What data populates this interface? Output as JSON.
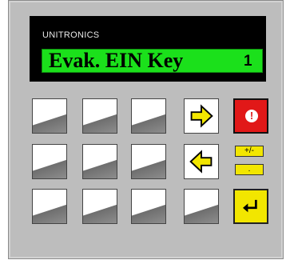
{
  "display": {
    "brand": "UNITRONICS",
    "message": "Evak. EIN Key",
    "value": "1"
  },
  "keys": {
    "plusminus_label": "+/-",
    "dot_label": ".",
    "esc_label": "!"
  },
  "colors": {
    "panel": "#bdbdbd",
    "lcd_background": "#1be01b",
    "arrow_fill": "#f2e600",
    "esc_key": "#e11818",
    "enter_key": "#f2e600"
  }
}
